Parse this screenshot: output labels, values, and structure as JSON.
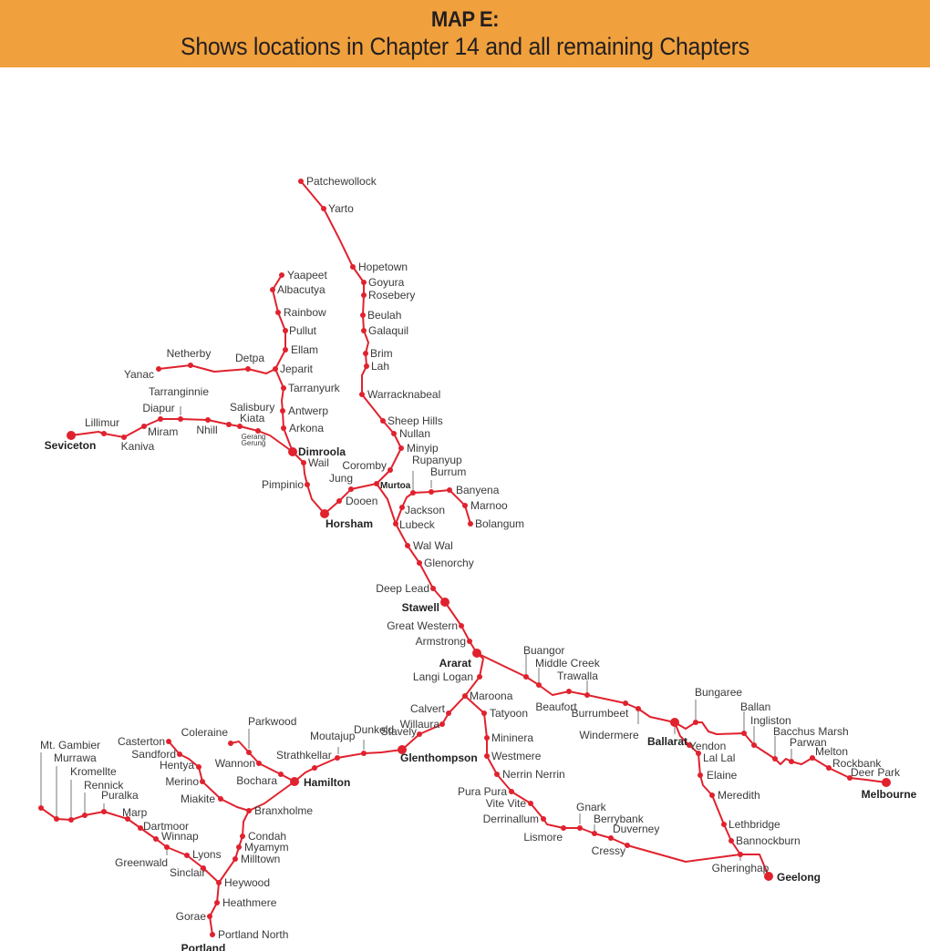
{
  "header": {
    "title": "MAP E:",
    "subtitle": "Shows locations in Chapter 14 and all remaining Chapters",
    "background_color": "#f0a03c"
  },
  "map": {
    "line_color": "#e0222e",
    "label_color": "#3a3a3a",
    "major_towns": [
      "Seviceton",
      "Dimroola",
      "Horsham",
      "Stawell",
      "Ararat",
      "Ballarat",
      "Melbourne",
      "Geelong",
      "Hamilton",
      "Glenthompson",
      "Portland"
    ],
    "stations": [
      {
        "id": "patchewollock",
        "name": "Patchewollock"
      },
      {
        "id": "yarto",
        "name": "Yarto"
      },
      {
        "id": "hopetown",
        "name": "Hopetown"
      },
      {
        "id": "goyura",
        "name": "Goyura"
      },
      {
        "id": "rosebery",
        "name": "Rosebery"
      },
      {
        "id": "beulah",
        "name": "Beulah"
      },
      {
        "id": "galaquil",
        "name": "Galaquil"
      },
      {
        "id": "brim",
        "name": "Brim"
      },
      {
        "id": "lah",
        "name": "Lah"
      },
      {
        "id": "warracknabeal",
        "name": "Warracknabeal"
      },
      {
        "id": "sheephills",
        "name": "Sheep Hills"
      },
      {
        "id": "nullan",
        "name": "Nullan"
      },
      {
        "id": "minyip",
        "name": "Minyip"
      },
      {
        "id": "corombly",
        "name": "Coromby"
      },
      {
        "id": "murtoa",
        "name": "Murtoa"
      },
      {
        "id": "yaapeet",
        "name": "Yaapeet"
      },
      {
        "id": "albacutya",
        "name": "Albacutya"
      },
      {
        "id": "rainbow",
        "name": "Rainbow"
      },
      {
        "id": "pullut",
        "name": "Pullut"
      },
      {
        "id": "ellam",
        "name": "Ellam"
      },
      {
        "id": "jeparit",
        "name": "Jeparit"
      },
      {
        "id": "tarranyurk",
        "name": "Tarranyurk"
      },
      {
        "id": "antwerp",
        "name": "Antwerp"
      },
      {
        "id": "arkona",
        "name": "Arkona"
      },
      {
        "id": "dimroola",
        "name": "Dimroola"
      },
      {
        "id": "yanac",
        "name": "Yanac"
      },
      {
        "id": "netherby",
        "name": "Netherby"
      },
      {
        "id": "detpa",
        "name": "Detpa"
      },
      {
        "id": "seviceton",
        "name": "Seviceton"
      },
      {
        "id": "lillimur",
        "name": "Lillimur"
      },
      {
        "id": "kaniva",
        "name": "Kaniva"
      },
      {
        "id": "miram",
        "name": "Miram"
      },
      {
        "id": "diapur",
        "name": "Diapur"
      },
      {
        "id": "tarranginnie",
        "name": "Tarranginnie"
      },
      {
        "id": "nhill",
        "name": "Nhill"
      },
      {
        "id": "salisbury",
        "name": "Salisbury"
      },
      {
        "id": "kiata",
        "name": "Kiata"
      },
      {
        "id": "gerang",
        "name": "Gerang Gerung"
      },
      {
        "id": "wail",
        "name": "Wail"
      },
      {
        "id": "pimpinio",
        "name": "Pimpinio"
      },
      {
        "id": "horsham",
        "name": "Horsham"
      },
      {
        "id": "dooen",
        "name": "Dooen"
      },
      {
        "id": "jung",
        "name": "Jung"
      },
      {
        "id": "rupanyup",
        "name": "Rupanyup"
      },
      {
        "id": "burrum",
        "name": "Burrum"
      },
      {
        "id": "banyena",
        "name": "Banyena"
      },
      {
        "id": "marnoo",
        "name": "Marnoo"
      },
      {
        "id": "bolangum",
        "name": "Bolangum"
      },
      {
        "id": "jackson",
        "name": "Jackson"
      },
      {
        "id": "lubeck",
        "name": "Lubeck"
      },
      {
        "id": "walwal",
        "name": "Wal Wal"
      },
      {
        "id": "glenorchy",
        "name": "Glenorchy"
      },
      {
        "id": "deeplead",
        "name": "Deep Lead"
      },
      {
        "id": "stawell",
        "name": "Stawell"
      },
      {
        "id": "greatwestern",
        "name": "Great Western"
      },
      {
        "id": "armstrong",
        "name": "Armstrong"
      },
      {
        "id": "ararat",
        "name": "Ararat"
      },
      {
        "id": "langilogan",
        "name": "Langi Logan"
      },
      {
        "id": "maroona",
        "name": "Maroona"
      },
      {
        "id": "calvert",
        "name": "Calvert"
      },
      {
        "id": "willaura",
        "name": "Willaura"
      },
      {
        "id": "stavely",
        "name": "Stavely"
      },
      {
        "id": "glenthompson",
        "name": "Glenthompson"
      },
      {
        "id": "dunkeld",
        "name": "Dunkeld"
      },
      {
        "id": "moutajup",
        "name": "Moutajup"
      },
      {
        "id": "strathkellar",
        "name": "Strathkellar"
      },
      {
        "id": "hamilton",
        "name": "Hamilton"
      },
      {
        "id": "bochara",
        "name": "Bochara"
      },
      {
        "id": "wannon",
        "name": "Wannon"
      },
      {
        "id": "parkwood",
        "name": "Parkwood"
      },
      {
        "id": "coleraine",
        "name": "Coleraine"
      },
      {
        "id": "tatyoon",
        "name": "Tatyoon"
      },
      {
        "id": "mininera",
        "name": "Mininera"
      },
      {
        "id": "westmere",
        "name": "Westmere"
      },
      {
        "id": "nerrinnerrin",
        "name": "Nerrin Nerrin"
      },
      {
        "id": "purapura",
        "name": "Pura Pura"
      },
      {
        "id": "vitevite",
        "name": "Vite Vite"
      },
      {
        "id": "derrinallum",
        "name": "Derrinallum"
      },
      {
        "id": "lismore",
        "name": "Lismore"
      },
      {
        "id": "gnark",
        "name": "Gnark"
      },
      {
        "id": "berrybank",
        "name": "Berrybank"
      },
      {
        "id": "duverney",
        "name": "Duverney"
      },
      {
        "id": "cressy",
        "name": "Cressy"
      },
      {
        "id": "gheringhap",
        "name": "Gheringhap"
      },
      {
        "id": "geelong",
        "name": "Geelong"
      },
      {
        "id": "buangor",
        "name": "Buangor"
      },
      {
        "id": "middlecreek",
        "name": "Middle Creek"
      },
      {
        "id": "beaufort",
        "name": "Beaufort"
      },
      {
        "id": "trawalla",
        "name": "Trawalla"
      },
      {
        "id": "burrumbeet",
        "name": "Burrumbeet"
      },
      {
        "id": "windermere",
        "name": "Windermere"
      },
      {
        "id": "ballarat",
        "name": "Ballarat"
      },
      {
        "id": "bungaree",
        "name": "Bungaree"
      },
      {
        "id": "ballan",
        "name": "Ballan"
      },
      {
        "id": "ingliston",
        "name": "Ingliston"
      },
      {
        "id": "bacchusmarsh",
        "name": "Bacchus Marsh"
      },
      {
        "id": "parwan",
        "name": "Parwan"
      },
      {
        "id": "melton",
        "name": "Melton"
      },
      {
        "id": "rockbank",
        "name": "Rockbank"
      },
      {
        "id": "deerpark",
        "name": "Deer Park"
      },
      {
        "id": "melbourne",
        "name": "Melbourne"
      },
      {
        "id": "yendon",
        "name": "Yendon"
      },
      {
        "id": "lallal",
        "name": "Lal Lal"
      },
      {
        "id": "elaine",
        "name": "Elaine"
      },
      {
        "id": "meredith",
        "name": "Meredith"
      },
      {
        "id": "lethbridge",
        "name": "Lethbridge"
      },
      {
        "id": "bannockburn",
        "name": "Bannockburn"
      },
      {
        "id": "casterton",
        "name": "Casterton"
      },
      {
        "id": "sandford",
        "name": "Sandford"
      },
      {
        "id": "hentya",
        "name": "Hentya"
      },
      {
        "id": "merino",
        "name": "Merino"
      },
      {
        "id": "miakite",
        "name": "Miakite"
      },
      {
        "id": "branxholme",
        "name": "Branxholme"
      },
      {
        "id": "condah",
        "name": "Condah"
      },
      {
        "id": "myamym",
        "name": "Myamym"
      },
      {
        "id": "milltown",
        "name": "Milltown"
      },
      {
        "id": "heywood",
        "name": "Heywood"
      },
      {
        "id": "heathmere",
        "name": "Heathmere"
      },
      {
        "id": "gorae",
        "name": "Gorae"
      },
      {
        "id": "portlandnorth",
        "name": "Portland North"
      },
      {
        "id": "portland",
        "name": "Portland"
      },
      {
        "id": "mtgambier",
        "name": "Mt. Gambier"
      },
      {
        "id": "murrawa",
        "name": "Murrawa"
      },
      {
        "id": "kromellte",
        "name": "Kromellte"
      },
      {
        "id": "rennick",
        "name": "Rennick"
      },
      {
        "id": "puralka",
        "name": "Puralka"
      },
      {
        "id": "marp",
        "name": "Marp"
      },
      {
        "id": "dartmoor",
        "name": "Dartmoor"
      },
      {
        "id": "winnap",
        "name": "Winnap"
      },
      {
        "id": "greenwald",
        "name": "Greenwald"
      },
      {
        "id": "lyons",
        "name": "Lyons"
      },
      {
        "id": "sinclair",
        "name": "Sinclair"
      }
    ]
  }
}
